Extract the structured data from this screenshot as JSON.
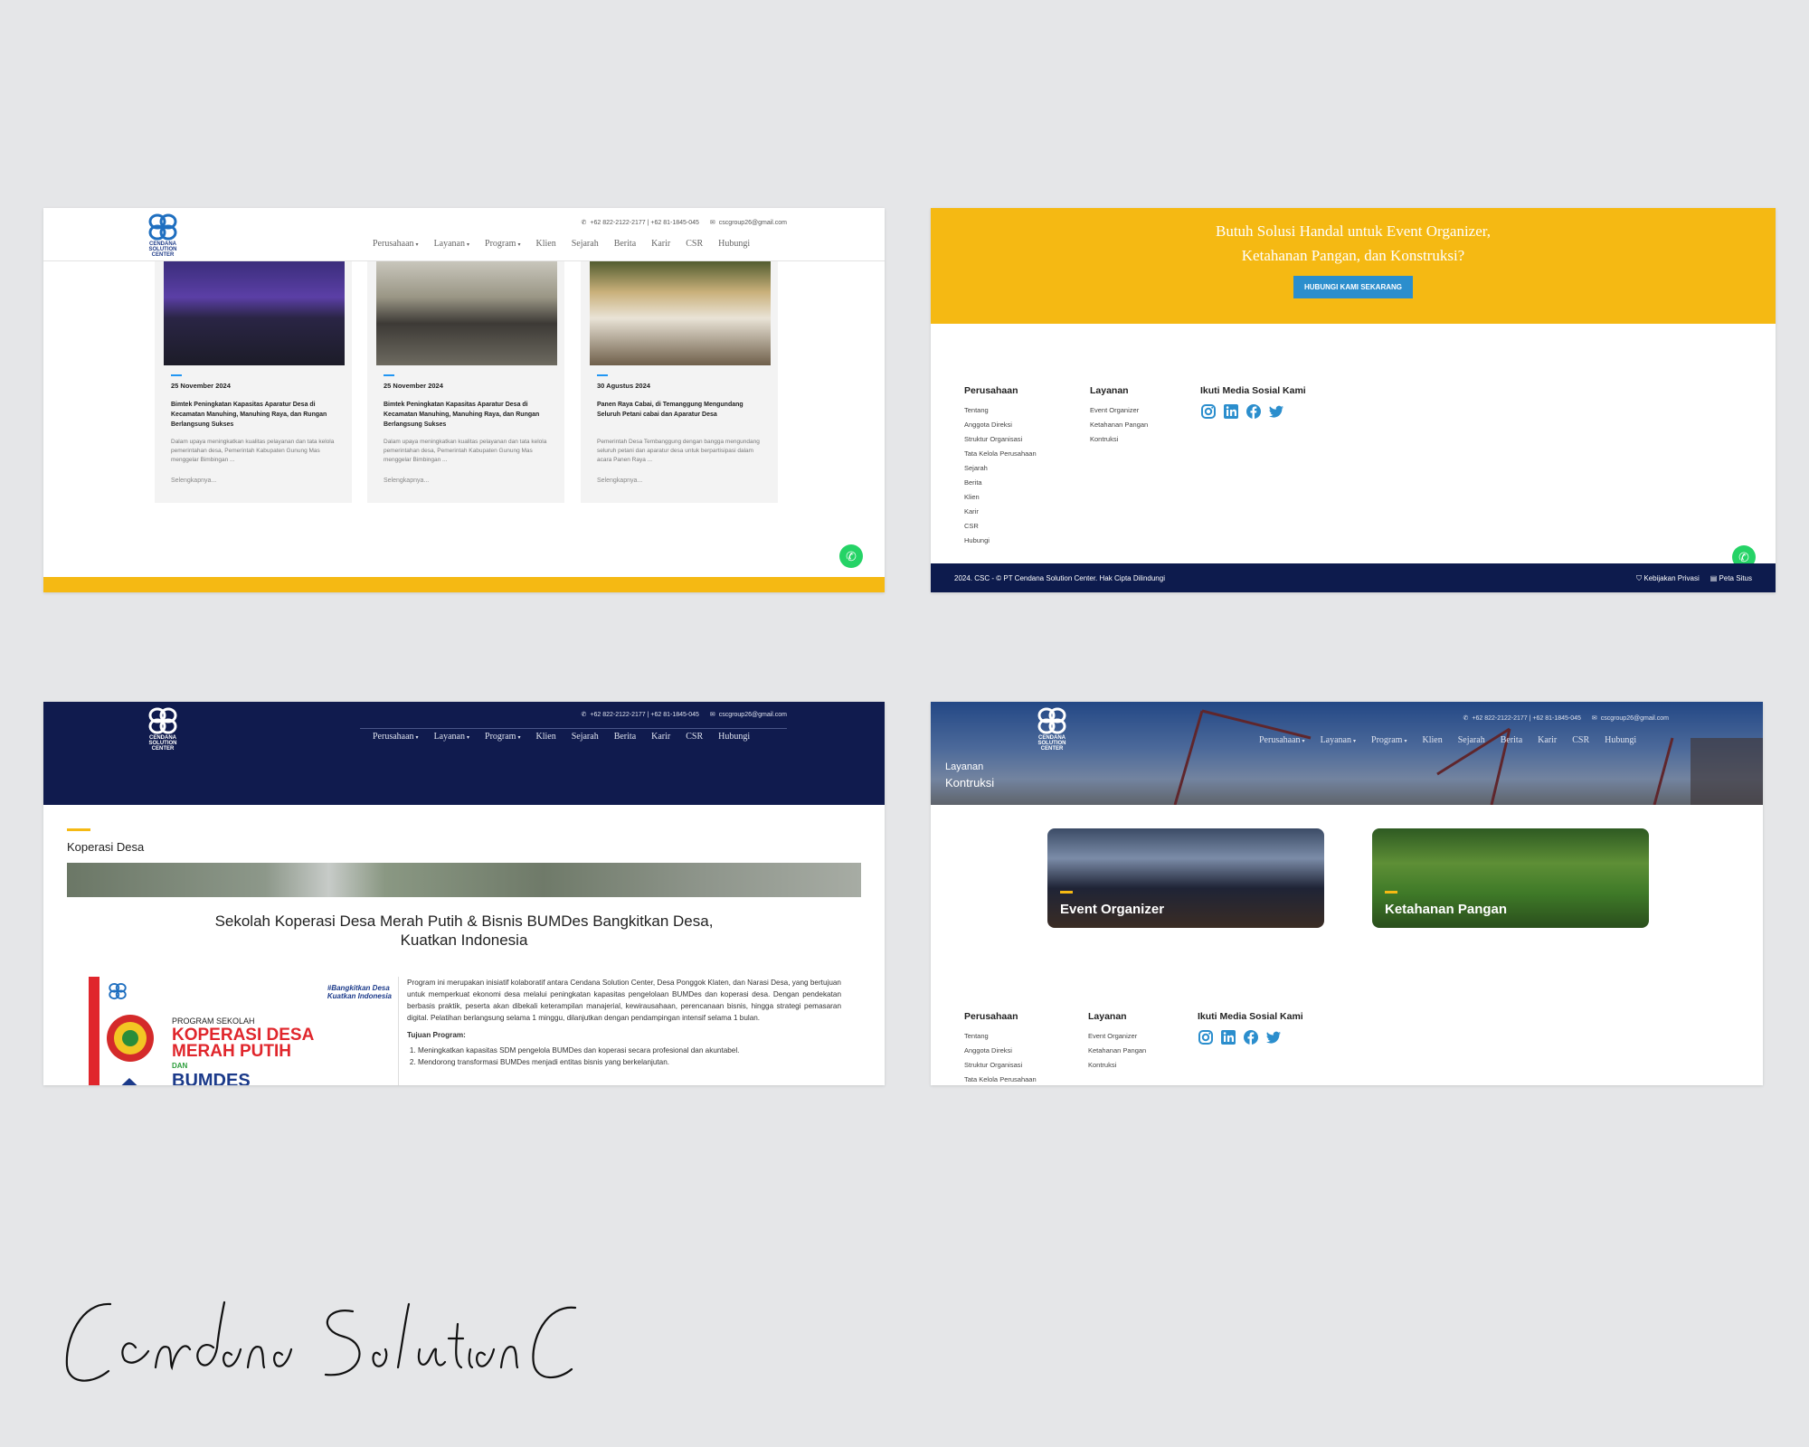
{
  "header": {
    "logo_text": "CENDANA SOLUTION CENTER",
    "phone": "+62 822-2122-2177 | +62 81-1845-045",
    "email": "cscgroup26@gmail.com",
    "nav": [
      "Perusahaan",
      "Layanan",
      "Program",
      "Klien",
      "Sejarah",
      "Berita",
      "Karir",
      "CSR",
      "Hubungi"
    ],
    "nav_caret": "▾"
  },
  "news": {
    "cards": [
      {
        "date": "25 November 2024",
        "title": "Bimtek Peningkatan Kapasitas Aparatur Desa di Kecamatan Manuhing, Manuhing Raya, dan Rungan Berlangsung Sukses",
        "excerpt": "Dalam upaya meningkatkan kualitas pelayanan dan tata kelola pemerintahan desa, Pemerintah Kabupaten Gunung Mas menggelar Bimbingan ...",
        "more": "Selengkapnya..."
      },
      {
        "date": "25 November 2024",
        "title": "Bimtek Peningkatan Kapasitas Aparatur Desa di Kecamatan Manuhing, Manuhing Raya, dan Rungan Berlangsung Sukses",
        "excerpt": "Dalam upaya meningkatkan kualitas pelayanan dan tata kelola pemerintahan desa, Pemerintah Kabupaten Gunung Mas menggelar Bimbingan ...",
        "more": "Selengkapnya..."
      },
      {
        "date": "30 Agustus 2024",
        "title": "Panen Raya Cabai, di Temanggung Mengundang Seluruh Petani cabai dan Aparatur Desa",
        "excerpt": "Pemerintah Desa Tembanggung dengan bangga mengundang seluruh petani dan aparatur desa untuk berpartisipasi dalam acara Panen Raya ...",
        "more": "Selengkapnya..."
      }
    ]
  },
  "cta": {
    "line1": "Butuh Solusi Handal untuk Event Organizer,",
    "line2": "Ketahanan Pangan, dan Konstruksi?",
    "button": "HUBUNGI KAMI SEKARANG"
  },
  "footer": {
    "perusahaan_title": "Perusahaan",
    "perusahaan_links": [
      "Tentang",
      "Anggota Direksi",
      "Struktur Organisasi",
      "Tata Kelola Perusahaan",
      "Sejarah",
      "Berita",
      "Klien",
      "Karir",
      "CSR",
      "Hubungi"
    ],
    "layanan_title": "Layanan",
    "layanan_links": [
      "Event Organizer",
      "Ketahanan Pangan",
      "Kontruksi"
    ],
    "social_title": "Ikuti Media Sosial Kami",
    "copyright": "2024. CSC - © PT Cendana Solution Center. Hak Cipta Dilindungi",
    "privacy": "Kebijakan Privasi",
    "sitemap": "Peta Situs"
  },
  "program_page": {
    "section_title": "Koperasi Desa",
    "headline_1": "Sekolah Koperasi Desa Merah Putih & Bisnis BUMDes Bangkitkan Desa,",
    "headline_2": "Kuatkan Indonesia",
    "poster_program": "PROGRAM SEKOLAH",
    "poster_big_1": "KOPERASI DESA",
    "poster_big_2": "MERAH PUTIH",
    "poster_dan": "DAN",
    "poster_bumdes": "BUMDES",
    "poster_tag_1": "#Bangkitkan Desa",
    "poster_tag_2": "Kuatkan Indonesia",
    "body": "Program ini merupakan inisiatif kolaboratif antara Cendana Solution Center, Desa Ponggok Klaten, dan Narasi Desa, yang bertujuan untuk memperkuat ekonomi desa melalui peningkatan kapasitas pengelolaan BUMDes dan koperasi desa. Dengan pendekatan berbasis praktik, peserta akan dibekali keterampilan manajerial, kewirausahaan, perencanaan bisnis, hingga strategi pemasaran digital. Pelatihan berlangsung selama 1 minggu, dilanjutkan dengan pendampingan intensif selama 1 bulan.",
    "tujuan_title": "Tujuan Program:",
    "tujuan": [
      "Meningkatkan kapasitas SDM pengelola BUMDes dan koperasi secara profesional dan akuntabel.",
      "Mendorong transformasi BUMDes menjadi entitas bisnis yang berkelanjutan."
    ]
  },
  "layanan_page": {
    "breadcrumb_sub": "Layanan",
    "title": "Kontruksi",
    "services": [
      "Event Organizer",
      "Ketahanan Pangan"
    ]
  },
  "colors": {
    "yellow": "#f5b913",
    "navy": "#0d1b4d",
    "blue_button": "#2b8ecd",
    "whatsapp": "#25d366"
  },
  "signature": "Cendana Solution Center"
}
